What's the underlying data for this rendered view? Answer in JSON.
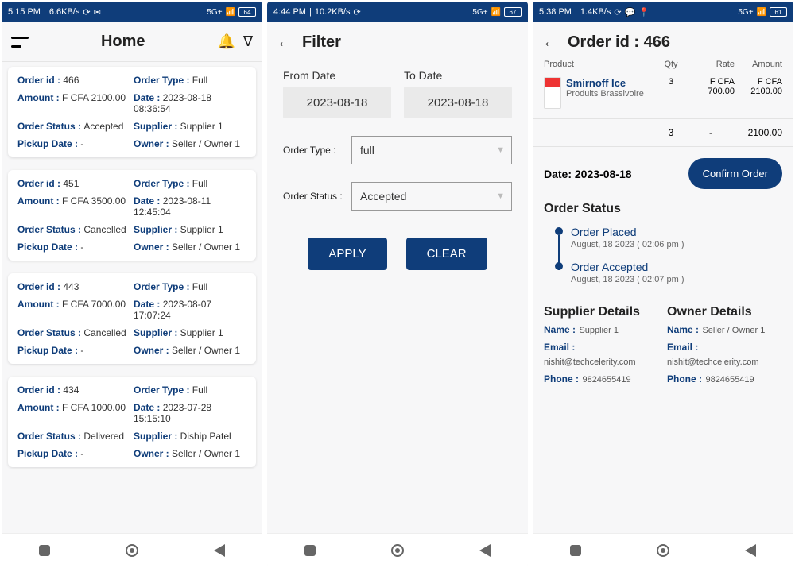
{
  "screens": {
    "home": {
      "status": {
        "time": "5:15 PM",
        "speed": "6.6KB/s",
        "battery": "64"
      },
      "title": "Home",
      "orders": [
        {
          "id": "466",
          "type": "Full",
          "amount": "F CFA 2100.00",
          "date": "2023-08-18 08:36:54",
          "status": "Accepted",
          "supplier": "Supplier 1",
          "pickup": "-",
          "owner": "Seller / Owner 1"
        },
        {
          "id": "451",
          "type": "Full",
          "amount": "F CFA 3500.00",
          "date": "2023-08-11 12:45:04",
          "status": "Cancelled",
          "supplier": "Supplier 1",
          "pickup": "-",
          "owner": "Seller / Owner 1"
        },
        {
          "id": "443",
          "type": "Full",
          "amount": "F CFA 7000.00",
          "date": "2023-08-07 17:07:24",
          "status": "Cancelled",
          "supplier": "Supplier 1",
          "pickup": "-",
          "owner": "Seller / Owner 1"
        },
        {
          "id": "434",
          "type": "Full",
          "amount": "F CFA 1000.00",
          "date": "2023-07-28 15:15:10",
          "status": "Delivered",
          "supplier": "Diship Patel",
          "pickup": "-",
          "owner": "Seller / Owner 1"
        }
      ],
      "labels": {
        "orderId": "Order id :",
        "orderType": "Order Type :",
        "amount": "Amount :",
        "date": "Date :",
        "orderStatus": "Order Status :",
        "supplier": "Supplier :",
        "pickup": "Pickup Date :",
        "owner": "Owner :"
      }
    },
    "filter": {
      "status": {
        "time": "4:44 PM",
        "speed": "10.2KB/s",
        "battery": "67"
      },
      "title": "Filter",
      "fromLabel": "From Date",
      "toLabel": "To Date",
      "fromDate": "2023-08-18",
      "toDate": "2023-08-18",
      "orderTypeLabel": "Order Type :",
      "orderTypeVal": "full",
      "orderStatusLabel": "Order Status :",
      "orderStatusVal": "Accepted",
      "apply": "APPLY",
      "clear": "CLEAR"
    },
    "detail": {
      "status": {
        "time": "5:38 PM",
        "speed": "1.4KB/s",
        "battery": "61"
      },
      "title": "Order id : 466",
      "cols": {
        "product": "Product",
        "qty": "Qty",
        "rate": "Rate",
        "amount": "Amount"
      },
      "item": {
        "name": "Smirnoff Ice",
        "desc": "Produits Brassivoire",
        "qty": "3",
        "rate": "F CFA 700.00",
        "amount": "F CFA 2100.00"
      },
      "total": {
        "qty": "3",
        "rate": "-",
        "amount": "2100.00"
      },
      "dateLabel": "Date: 2023-08-18",
      "confirm": "Confirm Order",
      "statusTitle": "Order Status",
      "timeline": [
        {
          "title": "Order Placed",
          "date": "August, 18 2023 ( 02:06 pm )"
        },
        {
          "title": "Order Accepted",
          "date": "August, 18 2023 ( 02:07 pm )"
        }
      ],
      "supplierTitle": "Supplier Details",
      "ownerTitle": "Owner Details",
      "supplier": {
        "name": "Supplier 1",
        "email": "nishit@techcelerity.com",
        "phone": "9824655419"
      },
      "owner": {
        "name": "Seller / Owner 1",
        "email": "nishit@techcelerity.com",
        "phone": "9824655419"
      },
      "dLabels": {
        "name": "Name :",
        "email": "Email :",
        "phone": "Phone :"
      }
    }
  }
}
